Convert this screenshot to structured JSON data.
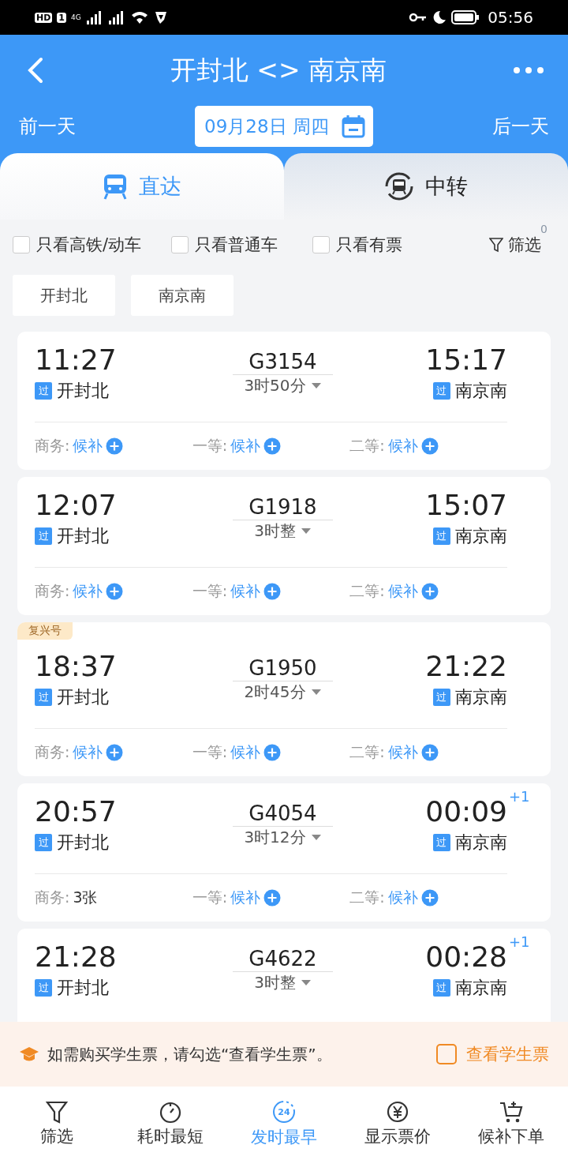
{
  "status_bar": {
    "badges": [
      "HD",
      "1"
    ],
    "network": "4G",
    "time": "05:56"
  },
  "header": {
    "title": "开封北 <> 南京南",
    "prev_day": "前一天",
    "date": "09月28日 周四",
    "next_day": "后一天"
  },
  "tabs": [
    {
      "label": "直达",
      "selected": true,
      "kind": "direct"
    },
    {
      "label": "中转",
      "selected": false,
      "kind": "transfer"
    }
  ],
  "filters": [
    {
      "label": "只看高铁/动车",
      "checked": false
    },
    {
      "label": "只看普通车",
      "checked": false
    },
    {
      "label": "只看有票",
      "checked": false
    }
  ],
  "filter_button": {
    "label": "筛选",
    "count": "0"
  },
  "stations": [
    "开封北",
    "南京南"
  ],
  "trains": [
    {
      "depart": "11:27",
      "from": "开封北",
      "from_tag": "过",
      "number": "G3154",
      "duration": "3时50分",
      "arrive": "15:17",
      "to": "南京南",
      "to_tag": "过",
      "seats": [
        {
          "label": "商务:",
          "value": "候补",
          "kind": "waitlist"
        },
        {
          "label": "一等:",
          "value": "候补",
          "kind": "waitlist"
        },
        {
          "label": "二等:",
          "value": "候补",
          "kind": "waitlist"
        }
      ]
    },
    {
      "depart": "12:07",
      "from": "开封北",
      "from_tag": "过",
      "number": "G1918",
      "duration": "3时整",
      "arrive": "15:07",
      "to": "南京南",
      "to_tag": "过",
      "seats": [
        {
          "label": "商务:",
          "value": "候补",
          "kind": "waitlist"
        },
        {
          "label": "一等:",
          "value": "候补",
          "kind": "waitlist"
        },
        {
          "label": "二等:",
          "value": "候补",
          "kind": "waitlist"
        }
      ]
    },
    {
      "badge": "复兴号",
      "depart": "18:37",
      "from": "开封北",
      "from_tag": "过",
      "number": "G1950",
      "duration": "2时45分",
      "arrive": "21:22",
      "to": "南京南",
      "to_tag": "过",
      "seats": [
        {
          "label": "商务:",
          "value": "候补",
          "kind": "waitlist"
        },
        {
          "label": "一等:",
          "value": "候补",
          "kind": "waitlist"
        },
        {
          "label": "二等:",
          "value": "候补",
          "kind": "waitlist"
        }
      ]
    },
    {
      "depart": "20:57",
      "from": "开封北",
      "from_tag": "过",
      "number": "G4054",
      "duration": "3时12分",
      "arrive": "00:09",
      "day_offset": "+1",
      "to": "南京南",
      "to_tag": "过",
      "seats": [
        {
          "label": "商务:",
          "value": "3张",
          "kind": "count"
        },
        {
          "label": "一等:",
          "value": "候补",
          "kind": "waitlist"
        },
        {
          "label": "二等:",
          "value": "候补",
          "kind": "waitlist"
        }
      ]
    },
    {
      "depart": "21:28",
      "from": "开封北",
      "from_tag": "过",
      "number": "G4622",
      "duration": "3时整",
      "arrive": "00:28",
      "day_offset": "+1",
      "to": "南京南",
      "to_tag": "过"
    }
  ],
  "student_banner": {
    "text": "如需购买学生票，请勾选“查看学生票”。",
    "option": "查看学生票",
    "checked": false
  },
  "bottom_nav": [
    {
      "label": "筛选",
      "kind": "filter",
      "selected": false
    },
    {
      "label": "耗时最短",
      "kind": "timer",
      "selected": false
    },
    {
      "label": "发时最早",
      "kind": "clock24",
      "icon_text": "24",
      "selected": true
    },
    {
      "label": "显示票价",
      "kind": "price",
      "selected": false
    },
    {
      "label": "候补下单",
      "kind": "cart",
      "selected": false
    }
  ]
}
